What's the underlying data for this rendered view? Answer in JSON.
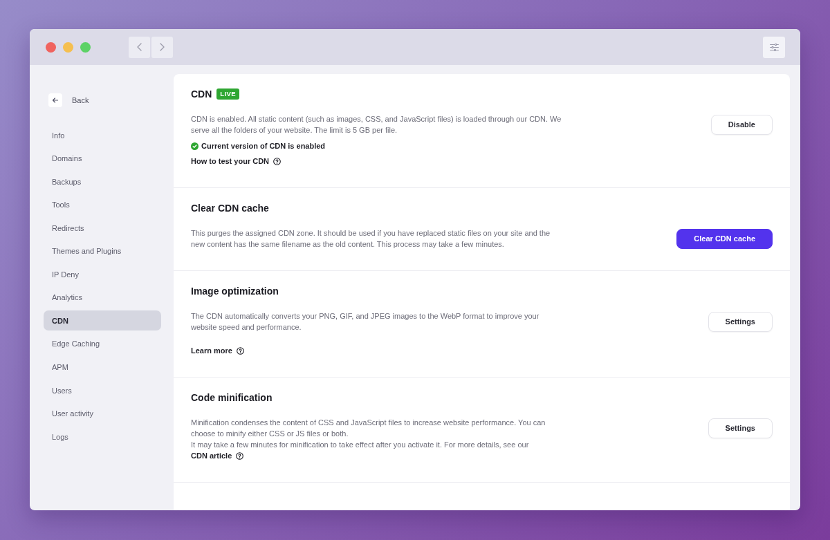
{
  "sidebar": {
    "back": "Back",
    "items": [
      {
        "label": "Info",
        "selected": false
      },
      {
        "label": "Domains",
        "selected": false
      },
      {
        "label": "Backups",
        "selected": false
      },
      {
        "label": "Tools",
        "selected": false
      },
      {
        "label": "Redirects",
        "selected": false
      },
      {
        "label": "Themes and Plugins",
        "selected": false
      },
      {
        "label": "IP Deny",
        "selected": false
      },
      {
        "label": "Analytics",
        "selected": false
      },
      {
        "label": "CDN",
        "selected": true
      },
      {
        "label": "Edge Caching",
        "selected": false
      },
      {
        "label": "APM",
        "selected": false
      },
      {
        "label": "Users",
        "selected": false
      },
      {
        "label": "User activity",
        "selected": false
      },
      {
        "label": "Logs",
        "selected": false
      }
    ]
  },
  "sections": [
    {
      "title": "CDN",
      "badge": "LIVE",
      "description": [
        {
          "text": "CDN is enabled. All static content (such as images, CSS, and JavaScript files) is loaded through our CDN. We serve all the folders of your website. The limit is 5 GB per file."
        }
      ],
      "status": "Current version of CDN is enabled",
      "link": "How to test your CDN",
      "button": {
        "label": "Disable",
        "kind": "secondary"
      }
    },
    {
      "title": "Clear CDN cache",
      "description": [
        {
          "text": "This purges the assigned CDN zone. It should be used if you have replaced static files on your site and the new content has the same filename as the old content. This process may take a few minutes."
        }
      ],
      "button": {
        "label": "Clear CDN cache",
        "kind": "primary"
      }
    },
    {
      "title": "Image optimization",
      "description": [
        {
          "text": "The CDN automatically converts your PNG, GIF, and JPEG images to the WebP format to improve your website speed and performance."
        }
      ],
      "link": "Learn more",
      "button": {
        "label": "Settings",
        "kind": "secondary"
      }
    },
    {
      "title": "Code minification",
      "description": [
        {
          "text": "Minification condenses the content of CSS and JavaScript files to increase website performance. You can choose to minify either CSS or JS files or both."
        },
        {
          "text": "It may take a few minutes for minification to take effect after you activate it. For more details, see our",
          "link": "CDN article"
        }
      ],
      "button": {
        "label": "Settings",
        "kind": "secondary"
      }
    }
  ]
}
